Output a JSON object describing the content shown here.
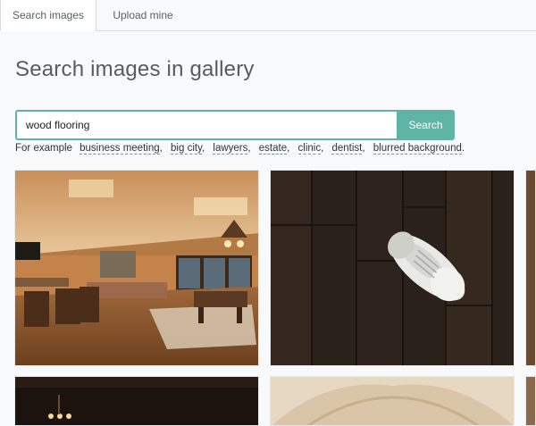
{
  "tabs": [
    {
      "label": "Search images",
      "active": true
    },
    {
      "label": "Upload mine",
      "active": false
    }
  ],
  "page_title": "Search images in gallery",
  "search": {
    "value": "wood flooring",
    "button_label": "Search"
  },
  "examples": {
    "prefix": "For example",
    "items": [
      "business meeting",
      "big city",
      "lawyers",
      "estate",
      "clinic",
      "dentist",
      "blurred background"
    ],
    "separator": ",",
    "end": "."
  },
  "colors": {
    "accent": "#5eb5a6",
    "background": "#f8f9fb"
  },
  "gallery": [
    {
      "name": "interior-wood-floor-room"
    },
    {
      "name": "sneaker-on-dark-wood"
    },
    {
      "name": "dark-room-chandelier"
    },
    {
      "name": "light-wood-arch"
    }
  ]
}
